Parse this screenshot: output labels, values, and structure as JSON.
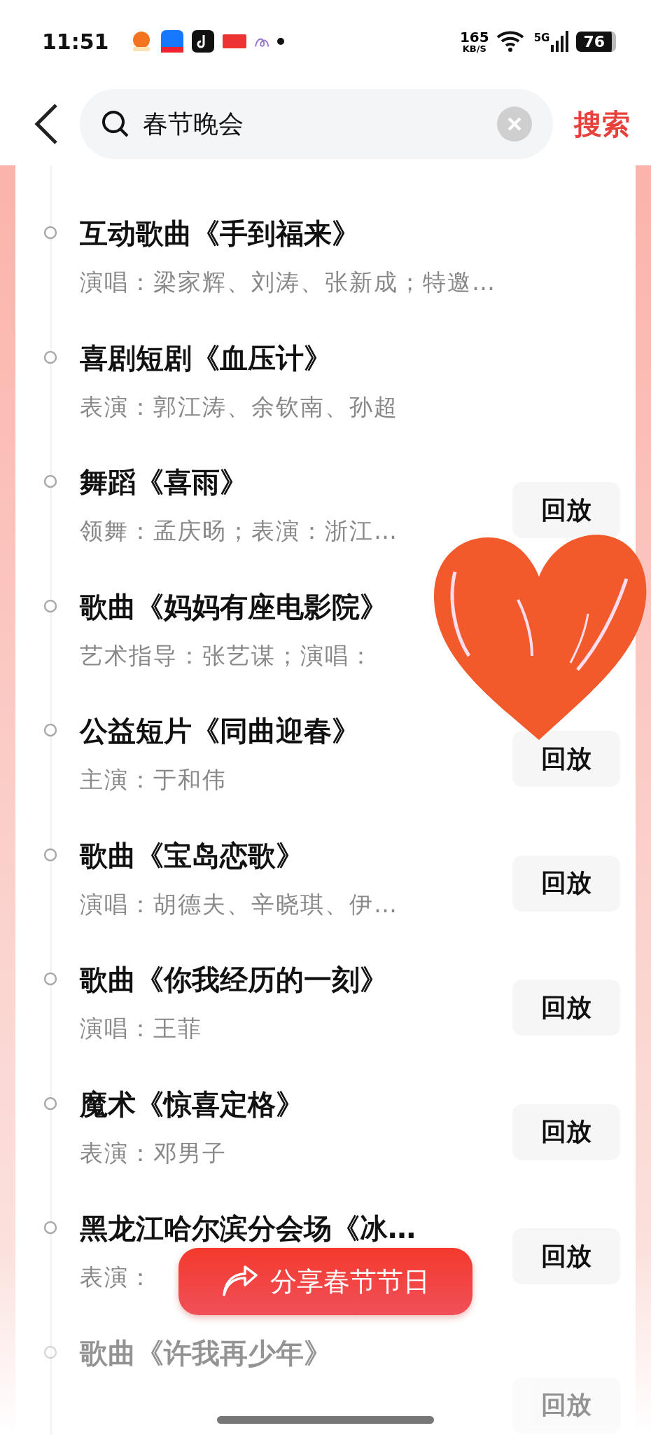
{
  "status_bar": {
    "time": "11:51",
    "speed": "165",
    "speed_unit": "KB/S",
    "network": "5G",
    "battery": "76"
  },
  "search": {
    "value": "春节晚会",
    "button": "搜索"
  },
  "programs": [
    {
      "title": "互动歌曲《手到福来》",
      "subtitle": "演唱：梁家辉、刘涛、张新成；特邀…",
      "faded": false
    },
    {
      "title": "喜剧短剧《血压计》",
      "subtitle": "表演：郭江涛、余钦南、孙超",
      "faded": false
    },
    {
      "title": "舞蹈《喜雨》",
      "subtitle": "领舞：孟庆旸；表演：浙江…",
      "button": "回放",
      "faded": false
    },
    {
      "title": "歌曲《妈妈有座电影院》",
      "subtitle": "艺术指导：张艺谋；演唱：",
      "faded": false
    },
    {
      "title": "公益短片《同曲迎春》",
      "subtitle": "主演：于和伟",
      "button": "回放",
      "faded": false
    },
    {
      "title": "歌曲《宝岛恋歌》",
      "subtitle": "演唱：胡德夫、辛晓琪、伊…",
      "button": "回放",
      "faded": false
    },
    {
      "title": "歌曲《你我经历的一刻》",
      "subtitle": "演唱：王菲",
      "button": "回放",
      "faded": false
    },
    {
      "title": "魔术《惊喜定格》",
      "subtitle": "表演：邓男子",
      "button": "回放",
      "faded": false
    },
    {
      "title": "黑龙江哈尔滨分会场《冰…",
      "subtitle": "表演：",
      "button": "回放",
      "faded": false
    },
    {
      "title": "歌曲《许我再少年》",
      "button": "回放",
      "faded": true
    }
  ],
  "share_button": "分享春节节日"
}
